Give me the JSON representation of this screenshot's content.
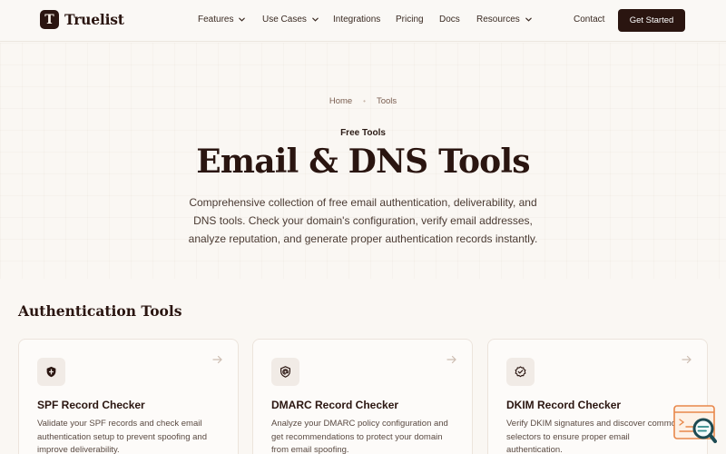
{
  "brand": {
    "name": "Truelist",
    "mark": "T"
  },
  "nav": {
    "items": [
      {
        "label": "Features",
        "dropdown": true
      },
      {
        "label": "Use Cases",
        "dropdown": true
      },
      {
        "label": "Integrations",
        "dropdown": false
      },
      {
        "label": "Pricing",
        "dropdown": false
      },
      {
        "label": "Docs",
        "dropdown": false
      },
      {
        "label": "Resources",
        "dropdown": true
      }
    ],
    "contact": "Contact",
    "cta": "Get Started"
  },
  "breadcrumb": {
    "home": "Home",
    "current": "Tools"
  },
  "hero": {
    "eyebrow": "Free Tools",
    "title": "Email & DNS Tools",
    "description": "Comprehensive collection of free email authentication, deliverability, and DNS tools. Check your domain's configuration, verify email addresses, analyze reputation, and generate proper authentication records instantly."
  },
  "section": {
    "title": "Authentication Tools",
    "cards": [
      {
        "icon": "shield-icon",
        "title": "SPF Record Checker",
        "description": "Validate your SPF records and check email authentication setup to prevent spoofing and improve deliverability."
      },
      {
        "icon": "at-sign-icon",
        "title": "DMARC Record Checker",
        "description": "Analyze your DMARC policy configuration and get recommendations to protect your domain from email spoofing."
      },
      {
        "icon": "verified-badge-icon",
        "title": "DKIM Record Checker",
        "description": "Verify DKIM signatures and discover common selectors to ensure proper email authentication."
      }
    ]
  },
  "colors": {
    "brand_dark": "#2a1510",
    "background": "#faf7f3",
    "widget_accent": "#e8874a"
  }
}
